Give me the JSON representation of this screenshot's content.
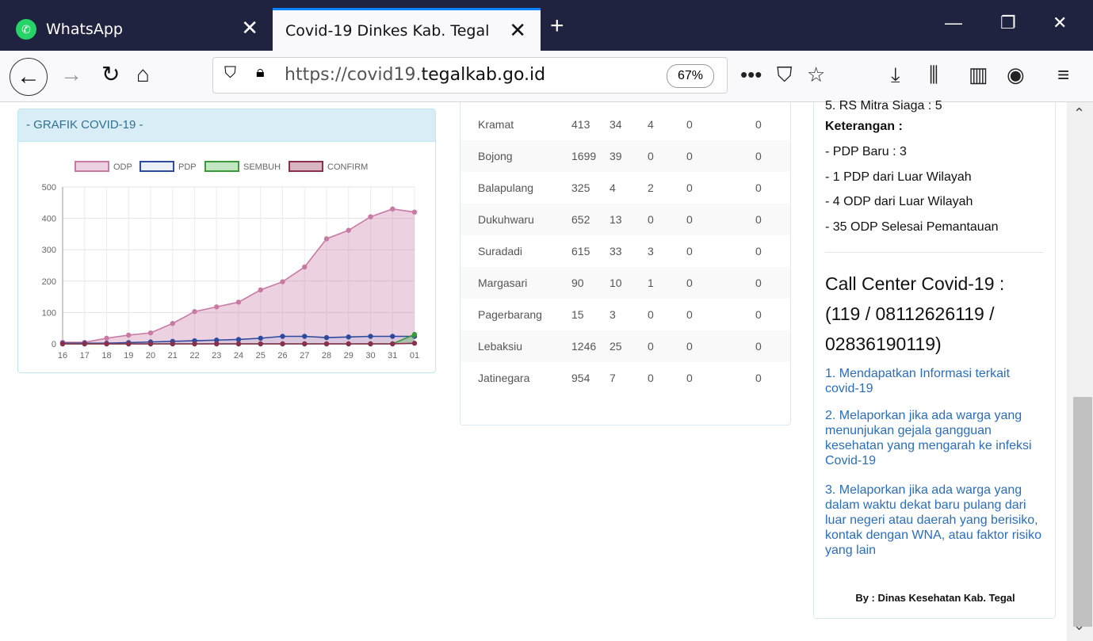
{
  "browser": {
    "tabs": [
      {
        "title": "WhatsApp",
        "active": false
      },
      {
        "title": "Covid-19 Dinkes Kab. Tegal",
        "active": true
      }
    ],
    "url_prefix": "https://covid19.",
    "url_domain": "tegalkab.go.id",
    "zoom": "67%"
  },
  "chart_panel": {
    "title": "- GRAFIK COVID-19 -"
  },
  "chart_data": {
    "type": "area",
    "x": [
      "16",
      "17",
      "18",
      "19",
      "20",
      "21",
      "22",
      "23",
      "24",
      "25",
      "26",
      "27",
      "28",
      "29",
      "30",
      "31",
      "01"
    ],
    "series": [
      {
        "name": "ODP",
        "values": [
          5,
          5,
          18,
          28,
          35,
          65,
          103,
          118,
          133,
          172,
          198,
          245,
          335,
          362,
          405,
          430,
          420
        ],
        "color": "#c87aa5"
      },
      {
        "name": "PDP",
        "values": [
          2,
          2,
          2,
          4,
          6,
          8,
          10,
          12,
          14,
          18,
          24,
          24,
          20,
          22,
          24,
          24,
          24
        ],
        "color": "#2e4a9e"
      },
      {
        "name": "SEMBUH",
        "values": [
          0,
          0,
          0,
          0,
          0,
          0,
          0,
          0,
          0,
          0,
          0,
          0,
          0,
          0,
          0,
          0,
          30
        ],
        "color": "#3a9a3a"
      },
      {
        "name": "CONFIRM",
        "values": [
          0,
          0,
          0,
          0,
          0,
          0,
          0,
          0,
          0,
          0,
          0,
          0,
          0,
          0,
          0,
          0,
          2
        ],
        "color": "#8b2f4f"
      }
    ],
    "ylim": [
      0,
      500
    ],
    "yticks": [
      "0",
      "100",
      "200",
      "300",
      "400",
      "500"
    ]
  },
  "table": {
    "rows": [
      [
        "Kramat",
        "413",
        "34",
        "4",
        "0",
        "0"
      ],
      [
        "Bojong",
        "1699",
        "39",
        "0",
        "0",
        "0"
      ],
      [
        "Balapulang",
        "325",
        "4",
        "2",
        "0",
        "0"
      ],
      [
        "Dukuhwaru",
        "652",
        "13",
        "0",
        "0",
        "0"
      ],
      [
        "Suradadi",
        "615",
        "33",
        "3",
        "0",
        "0"
      ],
      [
        "Margasari",
        "90",
        "10",
        "1",
        "0",
        "0"
      ],
      [
        "Pagerbarang",
        "15",
        "3",
        "0",
        "0",
        "0"
      ],
      [
        "Lebaksiu",
        "1246",
        "25",
        "0",
        "0",
        "0"
      ],
      [
        "Jatinegara",
        "954",
        "7",
        "0",
        "0",
        "0"
      ]
    ]
  },
  "sidebar": {
    "partial_line": "5. RS Mitra Siaga : 5",
    "keterangan_title": "Keterangan :",
    "keterangan": [
      "- PDP Baru : 3",
      "- 1 PDP dari Luar Wilayah",
      "- 4 ODP dari Luar Wilayah",
      "- 35 ODP Selesai Pemantauan"
    ],
    "call_center_lines": [
      "Call Center Covid-19 :",
      "(119 / 08112626119 /",
      "02836190119)"
    ],
    "links": [
      "1. Mendapatkan Informasi terkait covid-19",
      "2. Melaporkan jika ada warga yang menunjukan gejala gangguan kesehatan yang mengarah ke infeksi Covid-19",
      "3. Melaporkan jika ada warga yang dalam waktu dekat baru pulang dari luar negeri atau daerah yang berisiko, kontak dengan WNA, atau faktor risiko yang lain"
    ],
    "byline": "By : Dinas Kesehatan Kab. Tegal"
  }
}
